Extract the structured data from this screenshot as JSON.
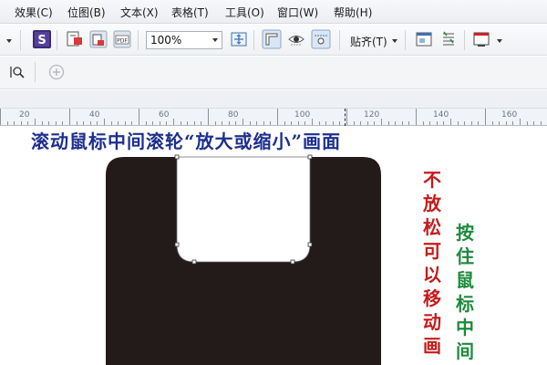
{
  "menu": [
    {
      "label": "效果(C)"
    },
    {
      "label": "位图(B)"
    },
    {
      "label": "文本(X)"
    },
    {
      "label": "表格(T)"
    },
    {
      "label": "工具(O)"
    },
    {
      "label": "窗口(W)"
    },
    {
      "label": "帮助(H)"
    }
  ],
  "toolbar": {
    "zoom_value": "100%",
    "snap_label": "贴齐(T)",
    "pdf_label": "PDF"
  },
  "ruler": {
    "labels": [
      "20",
      "40",
      "60",
      "80",
      "100",
      "120",
      "140",
      "160"
    ]
  },
  "canvas": {
    "caption": "滚动鼠标中间滚轮“放大或缩小”画面",
    "red_text": [
      "不",
      "放",
      "松",
      "可",
      "以",
      "移",
      "动",
      "画"
    ],
    "green_text": [
      "按",
      "住",
      "鼠",
      "标",
      "中",
      "间"
    ],
    "colors": {
      "caption": "#1d2f8f",
      "red_text": "#c61a1a",
      "green_text": "#1e8a3c",
      "shape_fill": "#231a1a"
    }
  }
}
